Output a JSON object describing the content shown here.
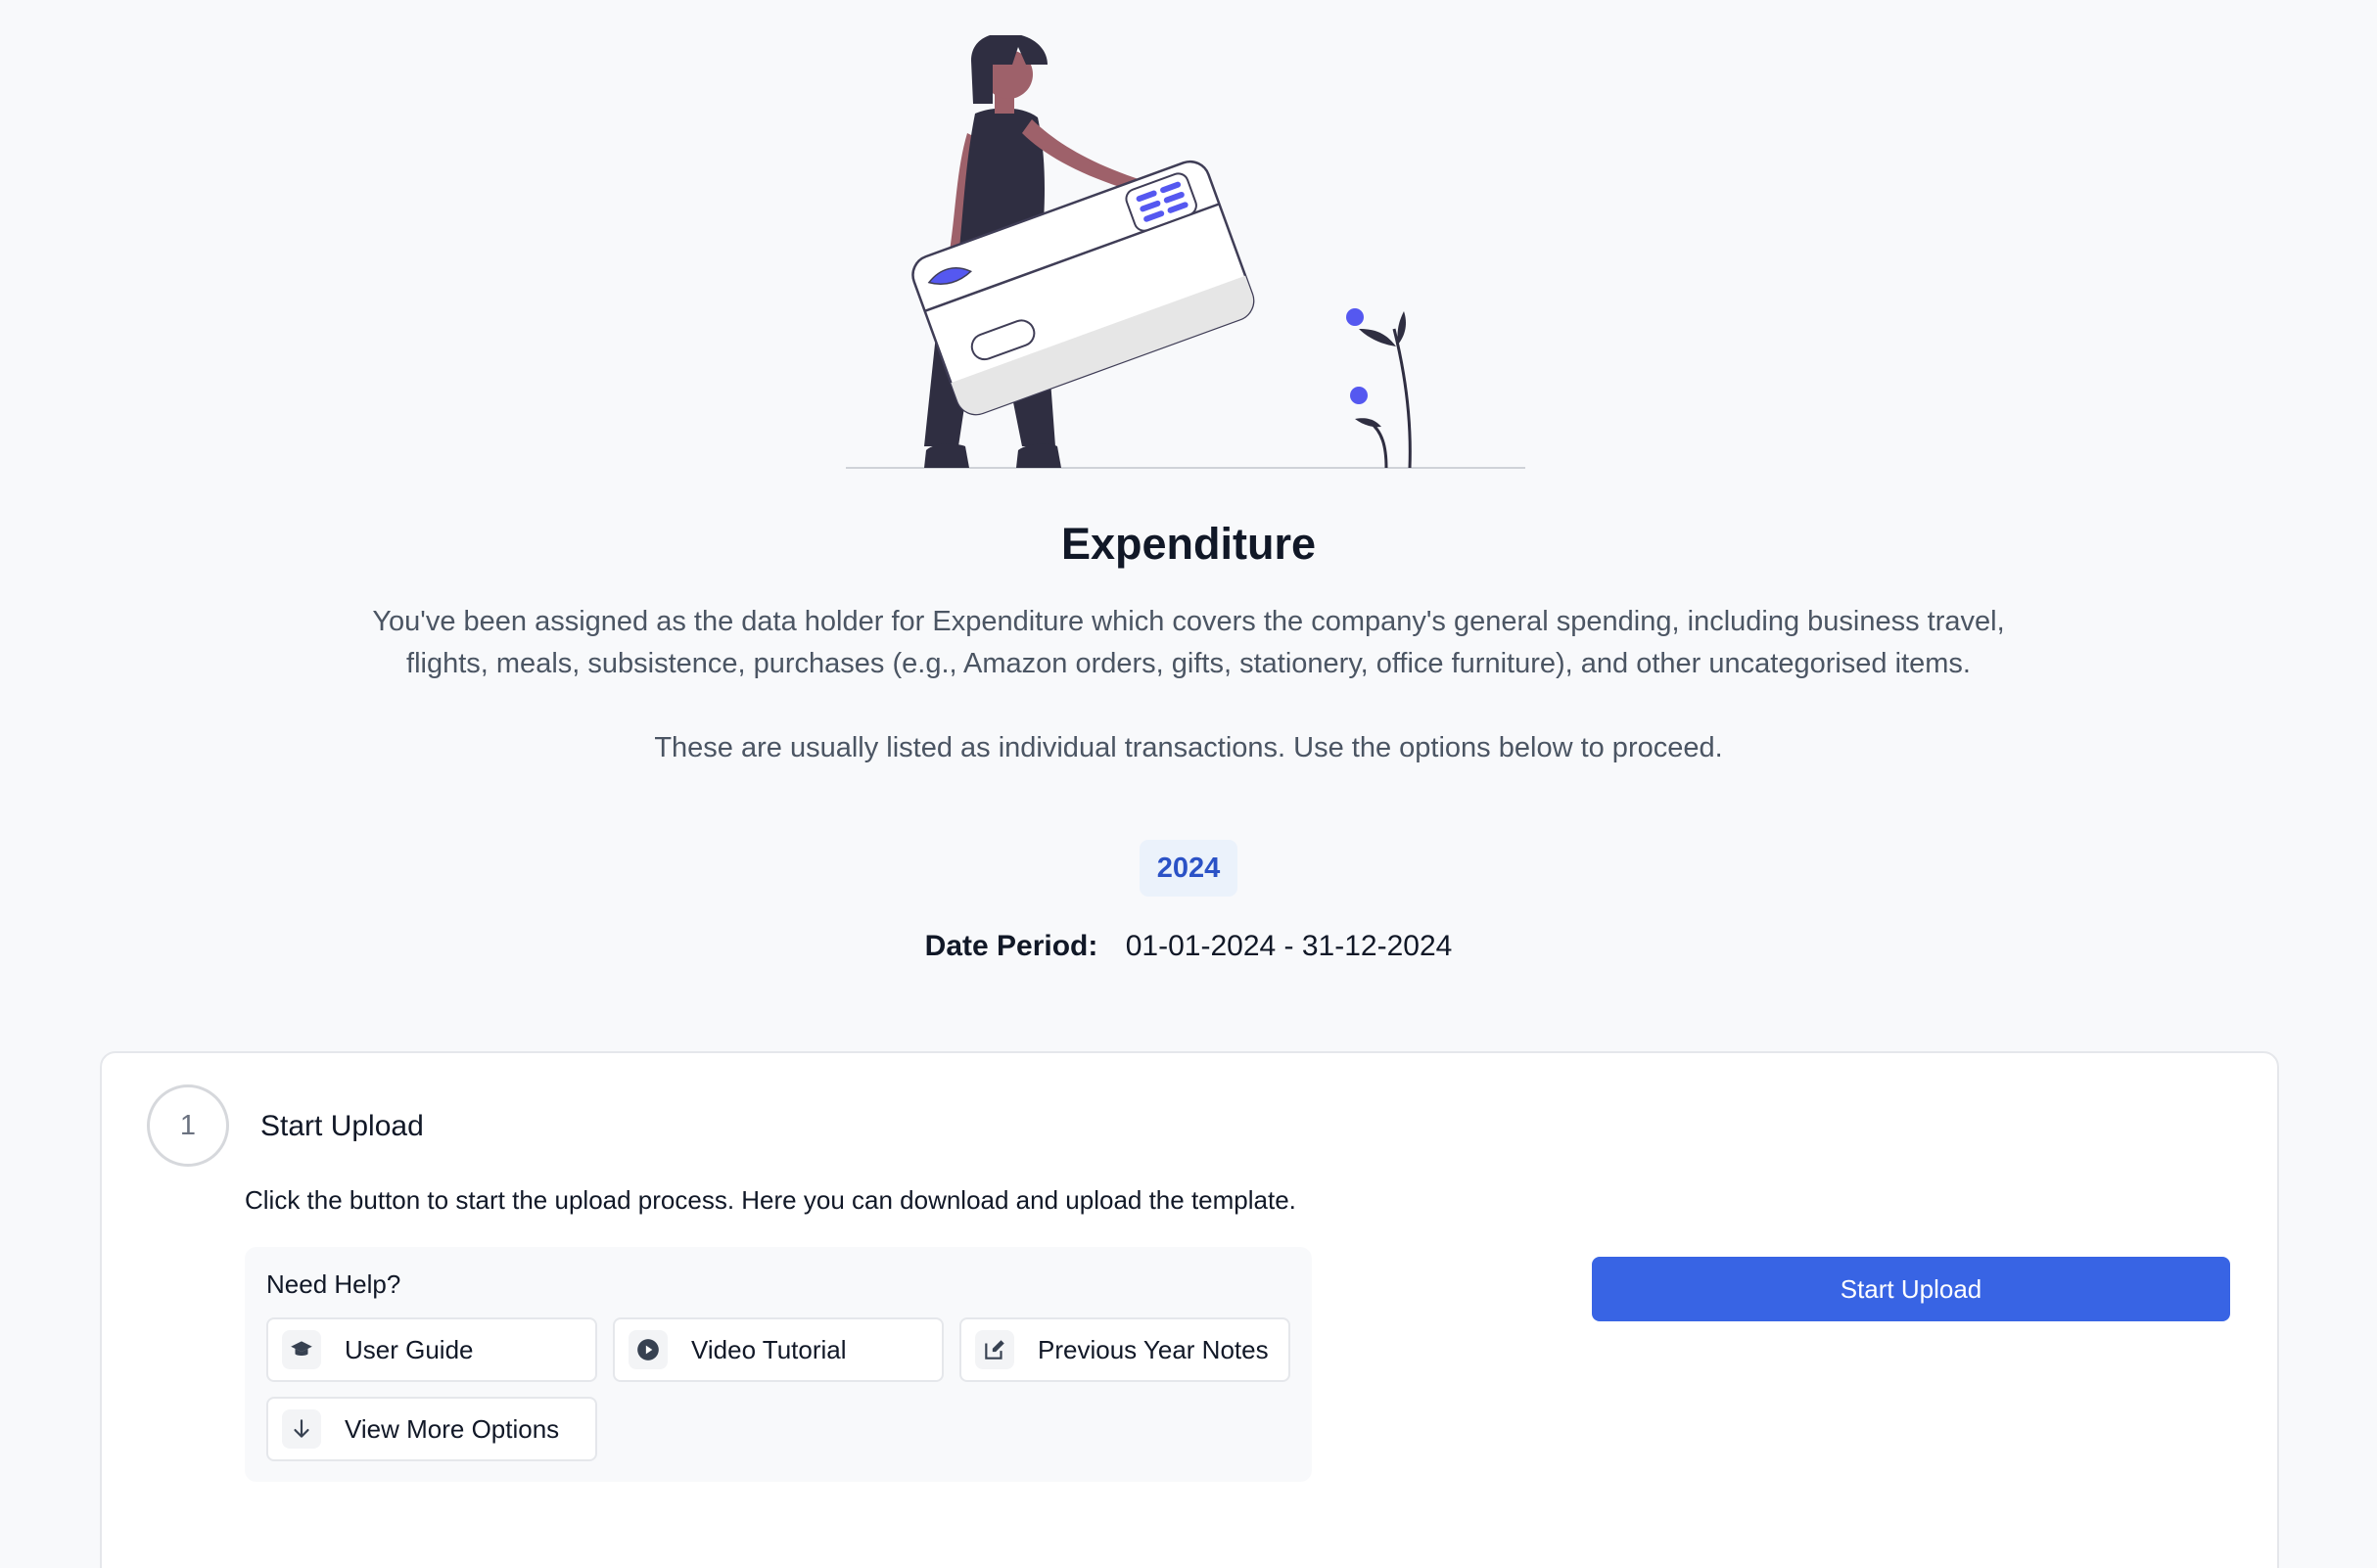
{
  "header": {
    "title": "Expenditure",
    "description_1": "You've been assigned as the data holder for Expenditure which covers the company's general spending, including business travel, flights, meals, subsistence, purchases (e.g., Amazon orders, gifts, stationery, office furniture), and other uncategorised items.",
    "description_2": "These are usually listed as individual transactions. Use the options below to proceed.",
    "year": "2024",
    "date_period_label": "Date Period:",
    "date_period_value": "01-01-2024 - 31-12-2024"
  },
  "step": {
    "number": "1",
    "title": "Start Upload",
    "description": "Click the button to start the upload process. Here you can download and upload the template.",
    "start_button": "Start Upload"
  },
  "help": {
    "title": "Need Help?",
    "items": [
      {
        "label": "User Guide",
        "icon": "graduation-cap-icon"
      },
      {
        "label": "Video Tutorial",
        "icon": "play-circle-icon"
      },
      {
        "label": "Previous Year Notes",
        "icon": "edit-note-icon"
      },
      {
        "label": "View More Options",
        "icon": "arrow-down-icon"
      }
    ]
  },
  "colors": {
    "accent": "#3864e4",
    "badge_bg": "#ebf2fb",
    "badge_text": "#2b52c6",
    "illustration_accent": "#5558f0",
    "figure_dark": "#2f2e41",
    "skin": "#9e616a"
  }
}
